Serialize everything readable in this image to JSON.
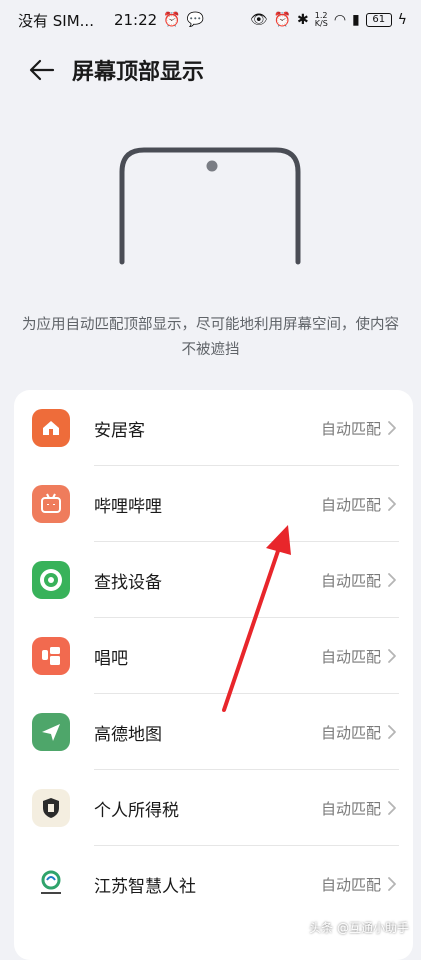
{
  "status_bar": {
    "carrier": "没有 SIM...",
    "time": "21:22",
    "network_speed_top": "1.2",
    "network_speed_unit": "K/S",
    "battery": "61"
  },
  "header": {
    "title": "屏幕顶部显示"
  },
  "description": "为应用自动匹配顶部显示，尽可能地利用屏幕空间，使内容不被遮挡",
  "apps": [
    {
      "name": "安居客",
      "value": "自动匹配",
      "icon": "anjuke-icon",
      "color": "#ee6c3a"
    },
    {
      "name": "哔哩哔哩",
      "value": "自动匹配",
      "icon": "bilibili-icon",
      "color": "#ef7c5c"
    },
    {
      "name": "查找设备",
      "value": "自动匹配",
      "icon": "find-device-icon",
      "color": "#38b25a"
    },
    {
      "name": "唱吧",
      "value": "自动匹配",
      "icon": "changba-icon",
      "color": "#f26a4f"
    },
    {
      "name": "高德地图",
      "value": "自动匹配",
      "icon": "amap-icon",
      "color": "#4ea66a"
    },
    {
      "name": "个人所得税",
      "value": "自动匹配",
      "icon": "tax-icon",
      "color": "#f4eee0"
    },
    {
      "name": "江苏智慧人社",
      "value": "自动匹配",
      "icon": "jiangsu-social-icon",
      "color": "#ffffff"
    }
  ],
  "watermark": "头条 @互通小助手",
  "colors": {
    "background": "#f1f2f6",
    "card": "#ffffff",
    "annotation_arrow": "#e8262b"
  }
}
